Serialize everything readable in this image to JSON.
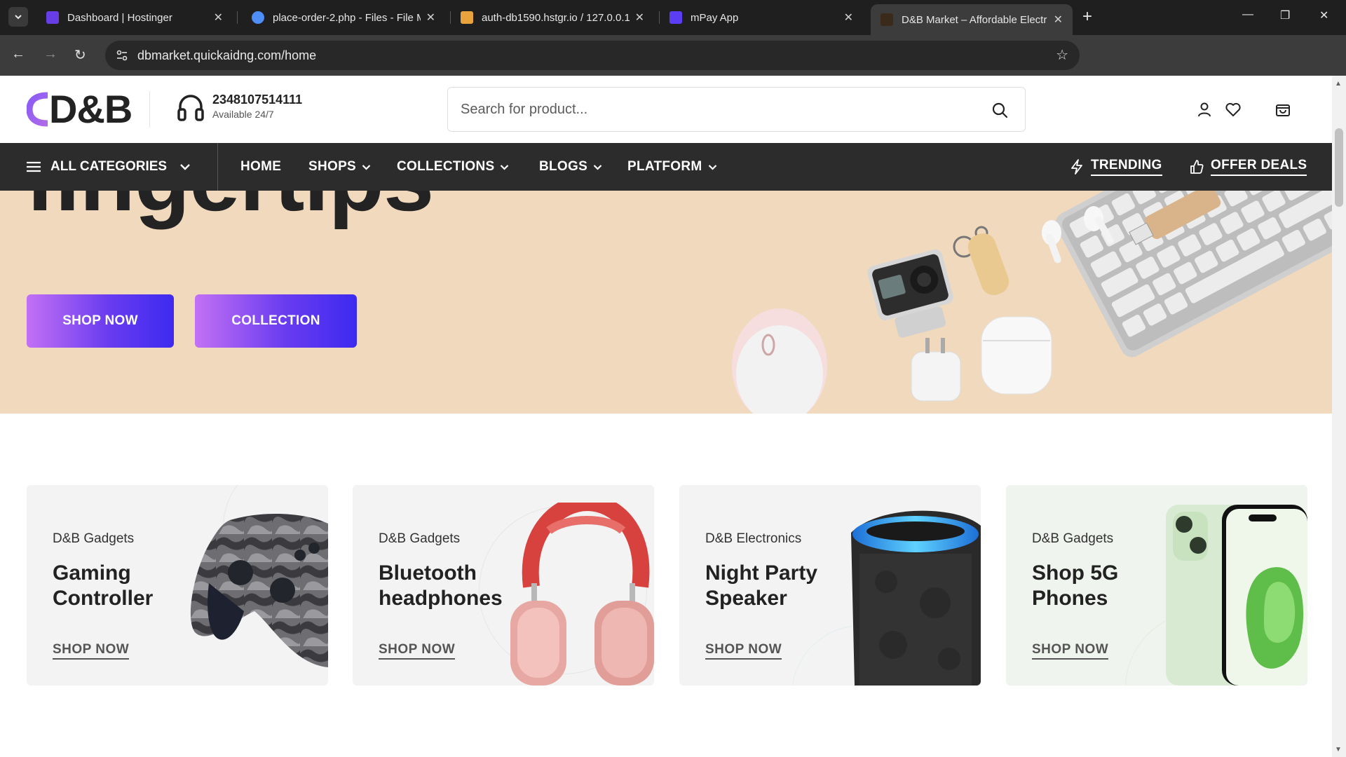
{
  "browser": {
    "tabs": [
      {
        "title": "Dashboard | Hostinger",
        "favicon_color": "#673de6"
      },
      {
        "title": "place-order-2.php - Files - File M",
        "favicon_color": "#4f8ef7"
      },
      {
        "title": "auth-db1590.hstgr.io / 127.0.0.1",
        "favicon_color": "#e8a33c"
      },
      {
        "title": "mPay App",
        "favicon_color": "#5b3df5"
      },
      {
        "title": "D&B Market – Affordable Electr",
        "favicon_color": "#3a2a1a"
      }
    ],
    "address": "dbmarket.quickaidng.com/home"
  },
  "header": {
    "logo_text": "D&B",
    "phone": "2348107514111",
    "availability": "Available 24/7",
    "search_placeholder": "Search for product..."
  },
  "nav": {
    "all_categories": "ALL CATEGORIES",
    "items": [
      "HOME",
      "SHOPS",
      "COLLECTIONS",
      "BLOGS",
      "PLATFORM"
    ],
    "trending": "TRENDING",
    "offer_deals": "OFFER DEALS"
  },
  "hero": {
    "title_fragment": "fingertips",
    "shop_now": "SHOP NOW",
    "collection": "COLLECTION"
  },
  "cards": [
    {
      "brand": "D&B Gadgets",
      "title_line1": "Gaming",
      "title_line2": "Controller",
      "cta": "SHOP NOW"
    },
    {
      "brand": "D&B Gadgets",
      "title_line1": "Bluetooth",
      "title_line2": "headphones",
      "cta": "SHOP NOW"
    },
    {
      "brand": "D&B Electronics",
      "title_line1": "Night Party",
      "title_line2": "Speaker",
      "cta": "SHOP NOW"
    },
    {
      "brand": "D&B Gadgets",
      "title_line1": "Shop 5G",
      "title_line2": "Phones",
      "cta": "SHOP NOW"
    }
  ],
  "colors": {
    "nav_bg": "#2c2c2c",
    "hero_bg": "#f1d9bd",
    "button_gradient_start": "#c371f4",
    "button_gradient_end": "#3d2aef",
    "card_bg": "#f3f3f3"
  }
}
